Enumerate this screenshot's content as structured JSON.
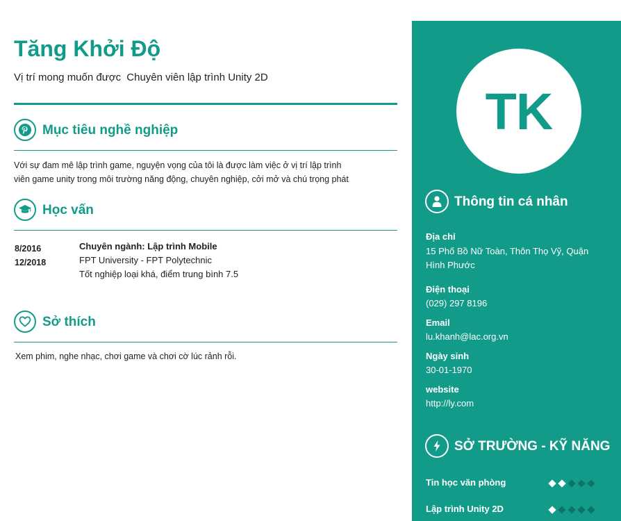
{
  "profile": {
    "name": "Tăng Khởi Độ",
    "position_label": "Vị trí mong muốn được",
    "position_value": "Chuyên viên lập trình Unity 2D",
    "initials": "TK"
  },
  "objective": {
    "title": "Mục tiêu nghề nghiệp",
    "icon": "pinterest-icon",
    "text_line1": "Với sự đam mê lập trình game, nguyện vọng của tôi là được làm việc ở vị trí lập trình",
    "text_line2": "viên game unity trong môi trường năng động, chuyên nghiệp, cởi mở và chú trọng phát"
  },
  "education": {
    "title": "Học vấn",
    "icon": "graduation-cap-icon",
    "entries": [
      {
        "start": "8/2016",
        "end": "12/2018",
        "major": "Chuyên ngành: Lập trình Mobile",
        "school": "FPT University - FPT Polytechnic",
        "result": "Tốt nghiệp loại khá, điểm trung bình 7.5"
      }
    ]
  },
  "hobbies": {
    "title": "Sở thích",
    "icon": "heart-icon",
    "text": "Xem phim, nghe nhạc, chơi game và chơi cờ lúc rảnh rỗi."
  },
  "personal_info": {
    "title": "Thông tin cá nhân",
    "icon": "user-icon",
    "address_label": "Địa chỉ",
    "address_line1": "15 Phố Bồ Nữ Toàn, Thôn Thọ Vỹ, Quận",
    "address_line2": "Hình Phước",
    "phone_label": "Điện thoại",
    "phone": "(029) 297 8196",
    "email_label": "Email",
    "email": "lu.khanh@lac.org.vn",
    "birthday_label": "Ngày sinh",
    "birthday": "30-01-1970",
    "website_label": "website",
    "website": "http://ly.com"
  },
  "skills": {
    "title": "SỞ TRƯỜNG - KỸ NĂNG",
    "icon": "lightning-icon",
    "items": [
      {
        "name": "Tin học văn phòng",
        "level": 2,
        "max": 5
      },
      {
        "name": "Lập trình Unity 2D",
        "level": 1,
        "max": 5
      }
    ]
  },
  "colors": {
    "accent": "#139b8a",
    "diamond_off": "#0c7467"
  }
}
